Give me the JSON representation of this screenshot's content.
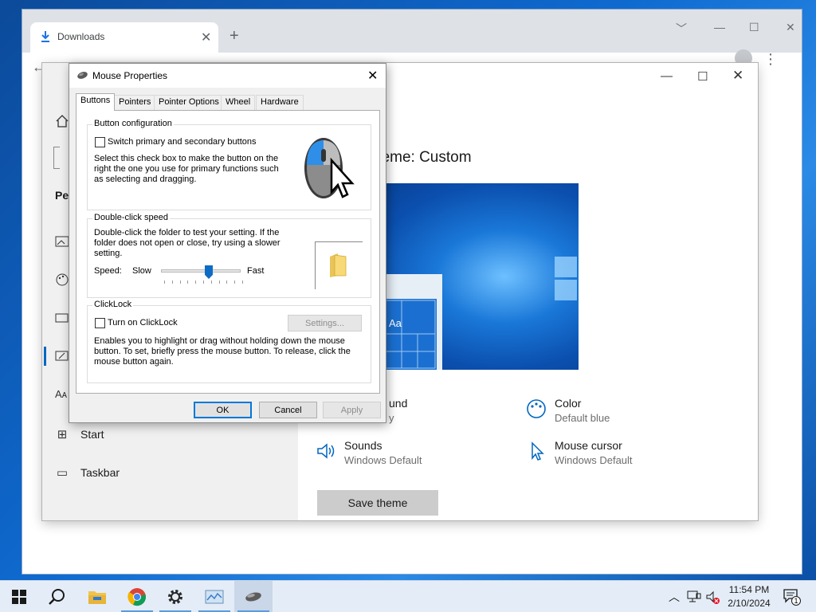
{
  "chrome": {
    "tab_title": "Downloads",
    "tab_close": "✕",
    "new_tab": "+",
    "min": "﹀",
    "minimize": "—",
    "maximize": "☐",
    "close": "✕",
    "back": "←"
  },
  "settings": {
    "sidebar": {
      "partial_label": "Pe",
      "items": [
        {
          "label": "Start",
          "icon": "start-icon"
        },
        {
          "label": "Taskbar",
          "icon": "taskbar-icon"
        }
      ]
    },
    "heading_partial": "s",
    "theme_heading": "heme: Custom",
    "preview_tile_text": "Aa",
    "options": [
      {
        "title": "und",
        "subtitle": "y",
        "icon": "background-icon"
      },
      {
        "title": "Color",
        "subtitle": "Default blue",
        "icon": "palette-icon"
      },
      {
        "title": "Sounds",
        "subtitle": "Windows Default",
        "icon": "speaker-icon"
      },
      {
        "title": "Mouse cursor",
        "subtitle": "Windows Default",
        "icon": "cursor-icon"
      }
    ],
    "save_theme": "Save theme",
    "more": "⋮"
  },
  "dialog": {
    "title": "Mouse Properties",
    "tabs": [
      "Buttons",
      "Pointers",
      "Pointer Options",
      "Wheel",
      "Hardware"
    ],
    "button_config": {
      "label": "Button configuration",
      "checkbox_label": "Switch primary and secondary buttons",
      "description": "Select this check box to make the button on the right the one you use for primary functions such as selecting and dragging."
    },
    "double_click": {
      "label": "Double-click speed",
      "description": "Double-click the folder to test your setting. If the folder does not open or close, try using a slower setting.",
      "speed_label": "Speed:",
      "slow": "Slow",
      "fast": "Fast",
      "speed_value_fraction": 0.6
    },
    "clicklock": {
      "label": "ClickLock",
      "checkbox_label": "Turn on ClickLock",
      "settings_button": "Settings...",
      "description": "Enables you to highlight or drag without holding down the mouse button. To set, briefly press the mouse button. To release, click the mouse button again."
    },
    "ok": "OK",
    "cancel": "Cancel",
    "apply": "Apply"
  },
  "taskbar": {
    "time": "11:54 PM",
    "date": "2/10/2024",
    "notification_count": "1"
  }
}
